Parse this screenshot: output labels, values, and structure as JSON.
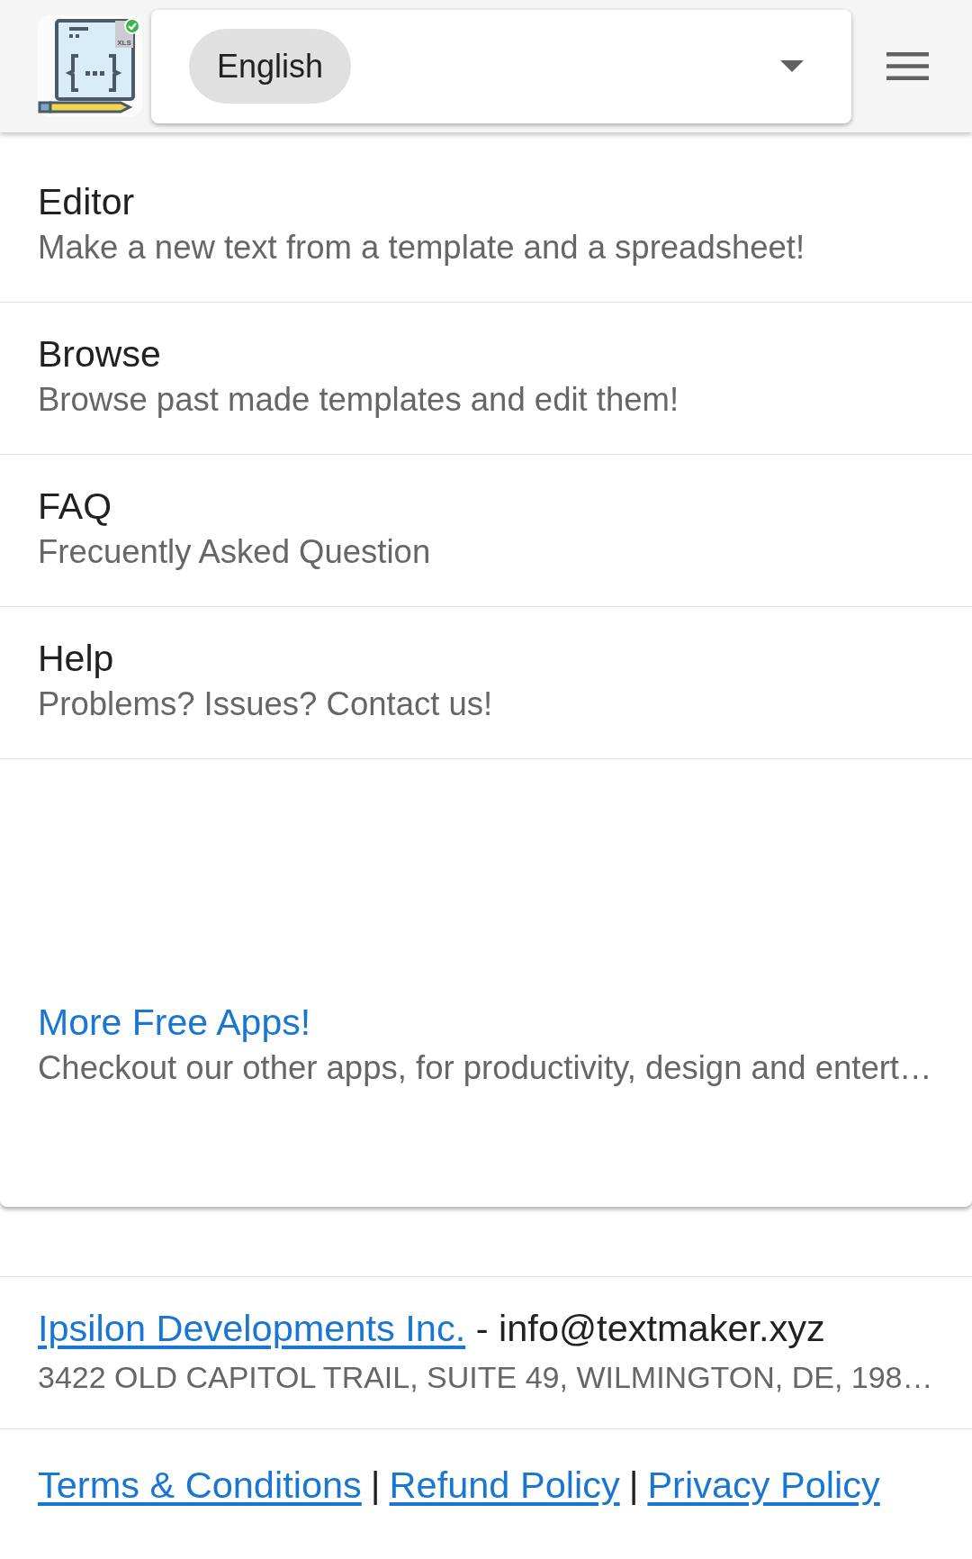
{
  "header": {
    "logo_text": "XLS",
    "language_select": {
      "value": "English"
    }
  },
  "menu": [
    {
      "title": "Editor",
      "description": "Make a new text from a template and a spreadsheet!"
    },
    {
      "title": "Browse",
      "description": "Browse past made templates and edit them!"
    },
    {
      "title": "FAQ",
      "description": "Frecuently Asked Question"
    },
    {
      "title": "Help",
      "description": "Problems? Issues? Contact us!"
    }
  ],
  "promo": {
    "title": "More Free Apps!",
    "description": "Checkout our other apps, for productivity, design and entert…"
  },
  "footer": {
    "company_link": "Ipsilon Developments Inc.",
    "email_text": "- info@textmaker.xyz",
    "address": "3422 OLD CAPITOL TRAIL, SUITE 49, WILMINGTON, DE, 198…",
    "links": [
      {
        "kind": "link",
        "text": "Terms & Conditions"
      },
      {
        "kind": "separator",
        "text": "|"
      },
      {
        "kind": "link",
        "text": "Refund Policy"
      },
      {
        "kind": "separator",
        "text": "|"
      },
      {
        "kind": "link",
        "text": "Privacy Policy"
      }
    ]
  }
}
